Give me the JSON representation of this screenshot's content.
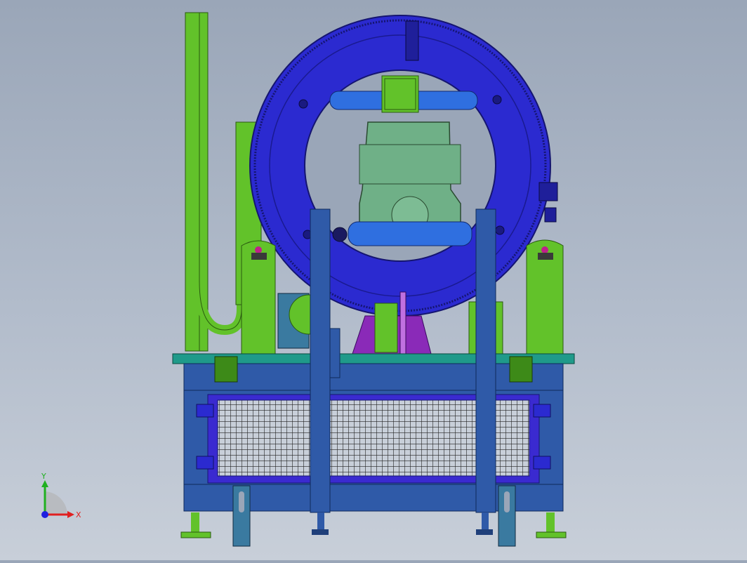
{
  "viewport": {
    "colors": {
      "ring": "#2b2ad0",
      "ring_dark": "#1f1f9a",
      "frame_blue": "#2f5aa8",
      "frame_dark": "#1f3f7a",
      "green": "#62c22a",
      "green_dark": "#3d8a18",
      "teal": "#1f9a8a",
      "pale_green": "#6fb087",
      "pipe_blue": "#2f6fe0",
      "purple": "#8a2ab8",
      "mesh": "#222222",
      "steel_blue": "#3a7aa0"
    }
  },
  "triad": {
    "y_label": "Y",
    "x_label": "X",
    "colors": {
      "x": "#e02020",
      "y": "#20b020",
      "z": "#2020e0"
    }
  }
}
